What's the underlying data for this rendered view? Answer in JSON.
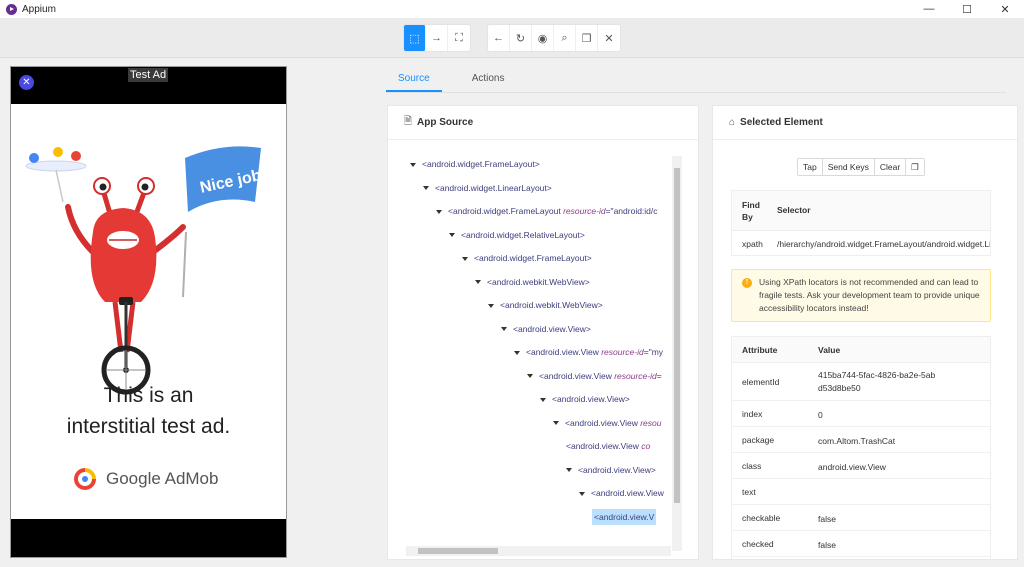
{
  "window": {
    "title": "Appium",
    "controls": [
      "—",
      "☐",
      "✕"
    ]
  },
  "toolbar": {
    "group1": [
      {
        "icon": "select-element-icon",
        "glyph": "⬚"
      },
      {
        "icon": "swipe-arrow-icon",
        "glyph": "→"
      },
      {
        "icon": "tap-coordinates-icon",
        "glyph": "⛶"
      }
    ],
    "group2": [
      {
        "icon": "back-icon",
        "glyph": "←"
      },
      {
        "icon": "refresh-icon",
        "glyph": "↻"
      },
      {
        "icon": "eye-icon",
        "glyph": "◉"
      },
      {
        "icon": "search-icon",
        "glyph": "⌕"
      },
      {
        "icon": "copy-icon",
        "glyph": "❐"
      },
      {
        "icon": "close-icon",
        "glyph": "✕"
      }
    ]
  },
  "device": {
    "close_glyph": "✕",
    "test_ad_label": "Test Ad",
    "banner_text": "Nice job!",
    "headline_line1": "This is an",
    "headline_line2": "interstitial test ad.",
    "brand": "Google AdMob"
  },
  "tabs": [
    {
      "label": "Source",
      "active": true
    },
    {
      "label": "Actions",
      "active": false
    }
  ],
  "source_panel": {
    "title": "App Source",
    "title_icon": "file-icon",
    "tree": [
      {
        "indent": 0,
        "caret": true,
        "tag": "<android.widget.FrameLayout>",
        "attr": "",
        "rest": ""
      },
      {
        "indent": 1,
        "caret": true,
        "tag": "<android.widget.LinearLayout>",
        "attr": "",
        "rest": ""
      },
      {
        "indent": 2,
        "caret": true,
        "tag": "<android.widget.FrameLayout ",
        "attr": "resource-id",
        "rest": "=\"android:id/c"
      },
      {
        "indent": 3,
        "caret": true,
        "tag": "<android.widget.RelativeLayout>",
        "attr": "",
        "rest": ""
      },
      {
        "indent": 4,
        "caret": true,
        "tag": "<android.widget.FrameLayout>",
        "attr": "",
        "rest": ""
      },
      {
        "indent": 5,
        "caret": true,
        "tag": "<android.webkit.WebView>",
        "attr": "",
        "rest": ""
      },
      {
        "indent": 6,
        "caret": true,
        "tag": "<android.webkit.WebView>",
        "attr": "",
        "rest": ""
      },
      {
        "indent": 7,
        "caret": true,
        "tag": "<android.view.View>",
        "attr": "",
        "rest": ""
      },
      {
        "indent": 8,
        "caret": true,
        "tag": "<android.view.View ",
        "attr": "resource-id",
        "rest": "=\"my"
      },
      {
        "indent": 9,
        "caret": true,
        "tag": "<android.view.View ",
        "attr": "resource-id",
        "rest": "="
      },
      {
        "indent": 10,
        "caret": true,
        "tag": "<android.view.View>",
        "attr": "",
        "rest": ""
      },
      {
        "indent": 11,
        "caret": true,
        "tag": "<android.view.View ",
        "attr": "resou",
        "rest": ""
      },
      {
        "indent": 12,
        "caret": false,
        "tag": "<android.view.View ",
        "attr": "co",
        "rest": ""
      },
      {
        "indent": 12,
        "caret": true,
        "tag": "<android.view.View>",
        "attr": "",
        "rest": ""
      },
      {
        "indent": 13,
        "caret": true,
        "tag": "<android.view.View",
        "attr": "",
        "rest": ""
      },
      {
        "indent": 14,
        "caret": false,
        "tag": "<android.view.V",
        "attr": "",
        "rest": "",
        "selected": true
      }
    ]
  },
  "selected_panel": {
    "title": "Selected Element",
    "title_icon": "tag-icon",
    "actions": [
      "Tap",
      "Send Keys",
      "Clear"
    ],
    "copy_glyph": "❐",
    "find": {
      "col1": "Find By",
      "col2": "Selector",
      "strategy": "xpath",
      "selector": "/hierarchy/android.widget.FrameLayout/android.widget.LinearLayout"
    },
    "warning": "Using XPath locators is not recommended and can lead to fragile tests. Ask your development team to provide unique accessibility locators instead!",
    "attr_col1": "Attribute",
    "attr_col2": "Value",
    "attributes": [
      {
        "name": "elementId",
        "value": "415ba744-5fac-4826-ba2e-5abd53d8be50"
      },
      {
        "name": "index",
        "value": "0"
      },
      {
        "name": "package",
        "value": "com.Altom.TrashCat"
      },
      {
        "name": "class",
        "value": "android.view.View"
      },
      {
        "name": "text",
        "value": ""
      },
      {
        "name": "checkable",
        "value": "false"
      },
      {
        "name": "checked",
        "value": "false"
      }
    ]
  },
  "colors": {
    "accent": "#1890ff",
    "monster": "#e53935",
    "banner": "#4a90e2"
  }
}
